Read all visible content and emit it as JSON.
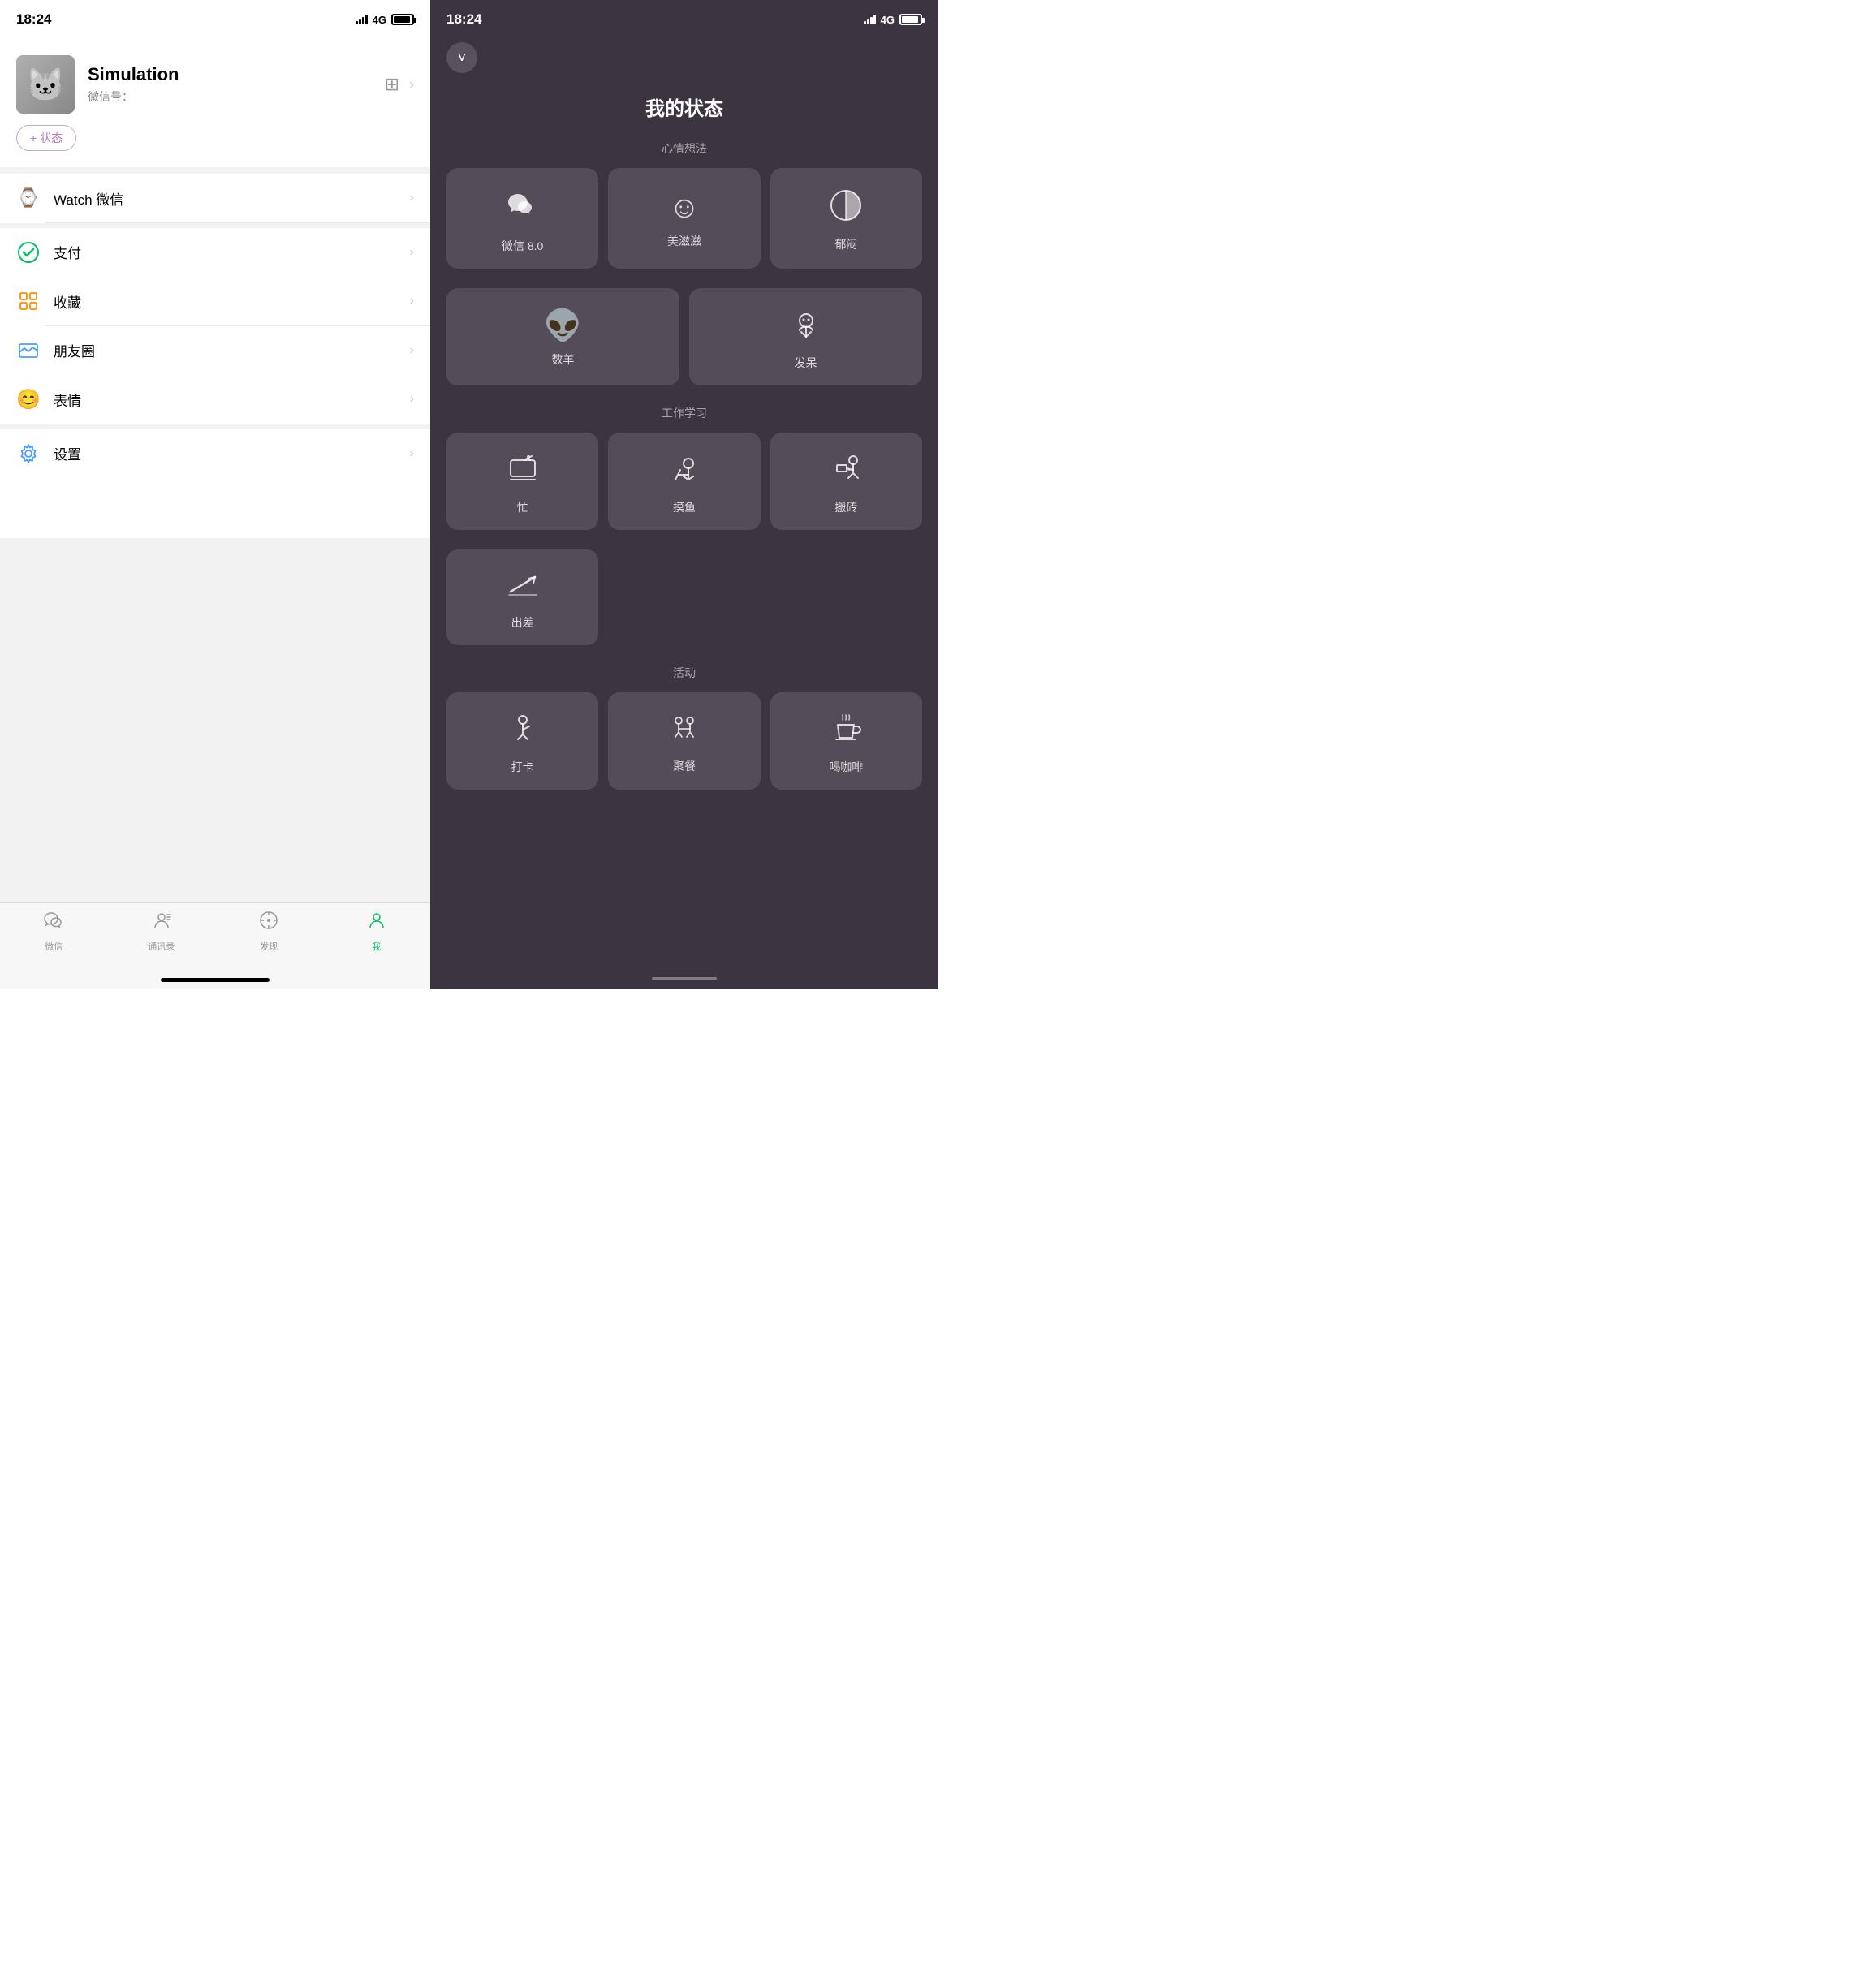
{
  "left": {
    "statusBar": {
      "time": "18:24",
      "networkType": "4G"
    },
    "profile": {
      "name": "Simulation",
      "wechatIdLabel": "微信号：",
      "statusBtnLabel": "+ 状态"
    },
    "menu": [
      {
        "id": "watch",
        "label": "Watch 微信",
        "iconEmoji": "⌚",
        "iconColor": "#7b5ea7"
      },
      {
        "id": "pay",
        "label": "支付",
        "iconEmoji": "✅",
        "iconColor": "#07c160"
      },
      {
        "id": "favorites",
        "label": "收藏",
        "iconEmoji": "📦",
        "iconColor": "#ff8c00"
      },
      {
        "id": "moments",
        "label": "朋友圈",
        "iconEmoji": "🖼",
        "iconColor": "#4a9eff"
      },
      {
        "id": "emoji",
        "label": "表情",
        "iconEmoji": "😊",
        "iconColor": "#ffc107"
      },
      {
        "id": "settings",
        "label": "设置",
        "iconEmoji": "⚙️",
        "iconColor": "#4a9eff"
      }
    ],
    "bottomNav": [
      {
        "id": "wechat",
        "label": "微信",
        "icon": "💬",
        "active": false
      },
      {
        "id": "contacts",
        "label": "通讯录",
        "icon": "👤",
        "active": false
      },
      {
        "id": "discover",
        "label": "发现",
        "icon": "🧭",
        "active": false
      },
      {
        "id": "me",
        "label": "我",
        "icon": "👤",
        "active": true
      }
    ]
  },
  "right": {
    "statusBar": {
      "time": "18:24",
      "networkType": "4G"
    },
    "backBtnIcon": "chevron-down",
    "pageTitle": "我的状态",
    "sections": [
      {
        "id": "mood",
        "label": "心情想法",
        "items": [
          {
            "id": "wechat80",
            "icon": "💬",
            "label": "微信 8.0"
          },
          {
            "id": "meizi",
            "icon": "😊",
            "label": "美滋滋"
          },
          {
            "id": "yumen",
            "icon": "🌓",
            "label": "郁闷"
          },
          {
            "id": "shuyang",
            "icon": "👽",
            "label": "数羊"
          },
          {
            "id": "fazhu",
            "icon": "🤔",
            "label": "发呆"
          }
        ]
      },
      {
        "id": "work",
        "label": "工作学习",
        "items": [
          {
            "id": "busy",
            "icon": "💻",
            "label": "忙"
          },
          {
            "id": "moyu",
            "icon": "🎣",
            "label": "摸鱼"
          },
          {
            "id": "banzhuang",
            "icon": "🏗",
            "label": "搬砖"
          },
          {
            "id": "chuchai",
            "icon": "✈️",
            "label": "出差"
          }
        ]
      },
      {
        "id": "activity",
        "label": "活动",
        "items": [
          {
            "id": "daka",
            "icon": "🚶",
            "label": "打卡"
          },
          {
            "id": "jucan",
            "icon": "🍽",
            "label": "聚餐"
          },
          {
            "id": "kafei",
            "icon": "☕",
            "label": "喝咖啡"
          }
        ]
      }
    ]
  }
}
